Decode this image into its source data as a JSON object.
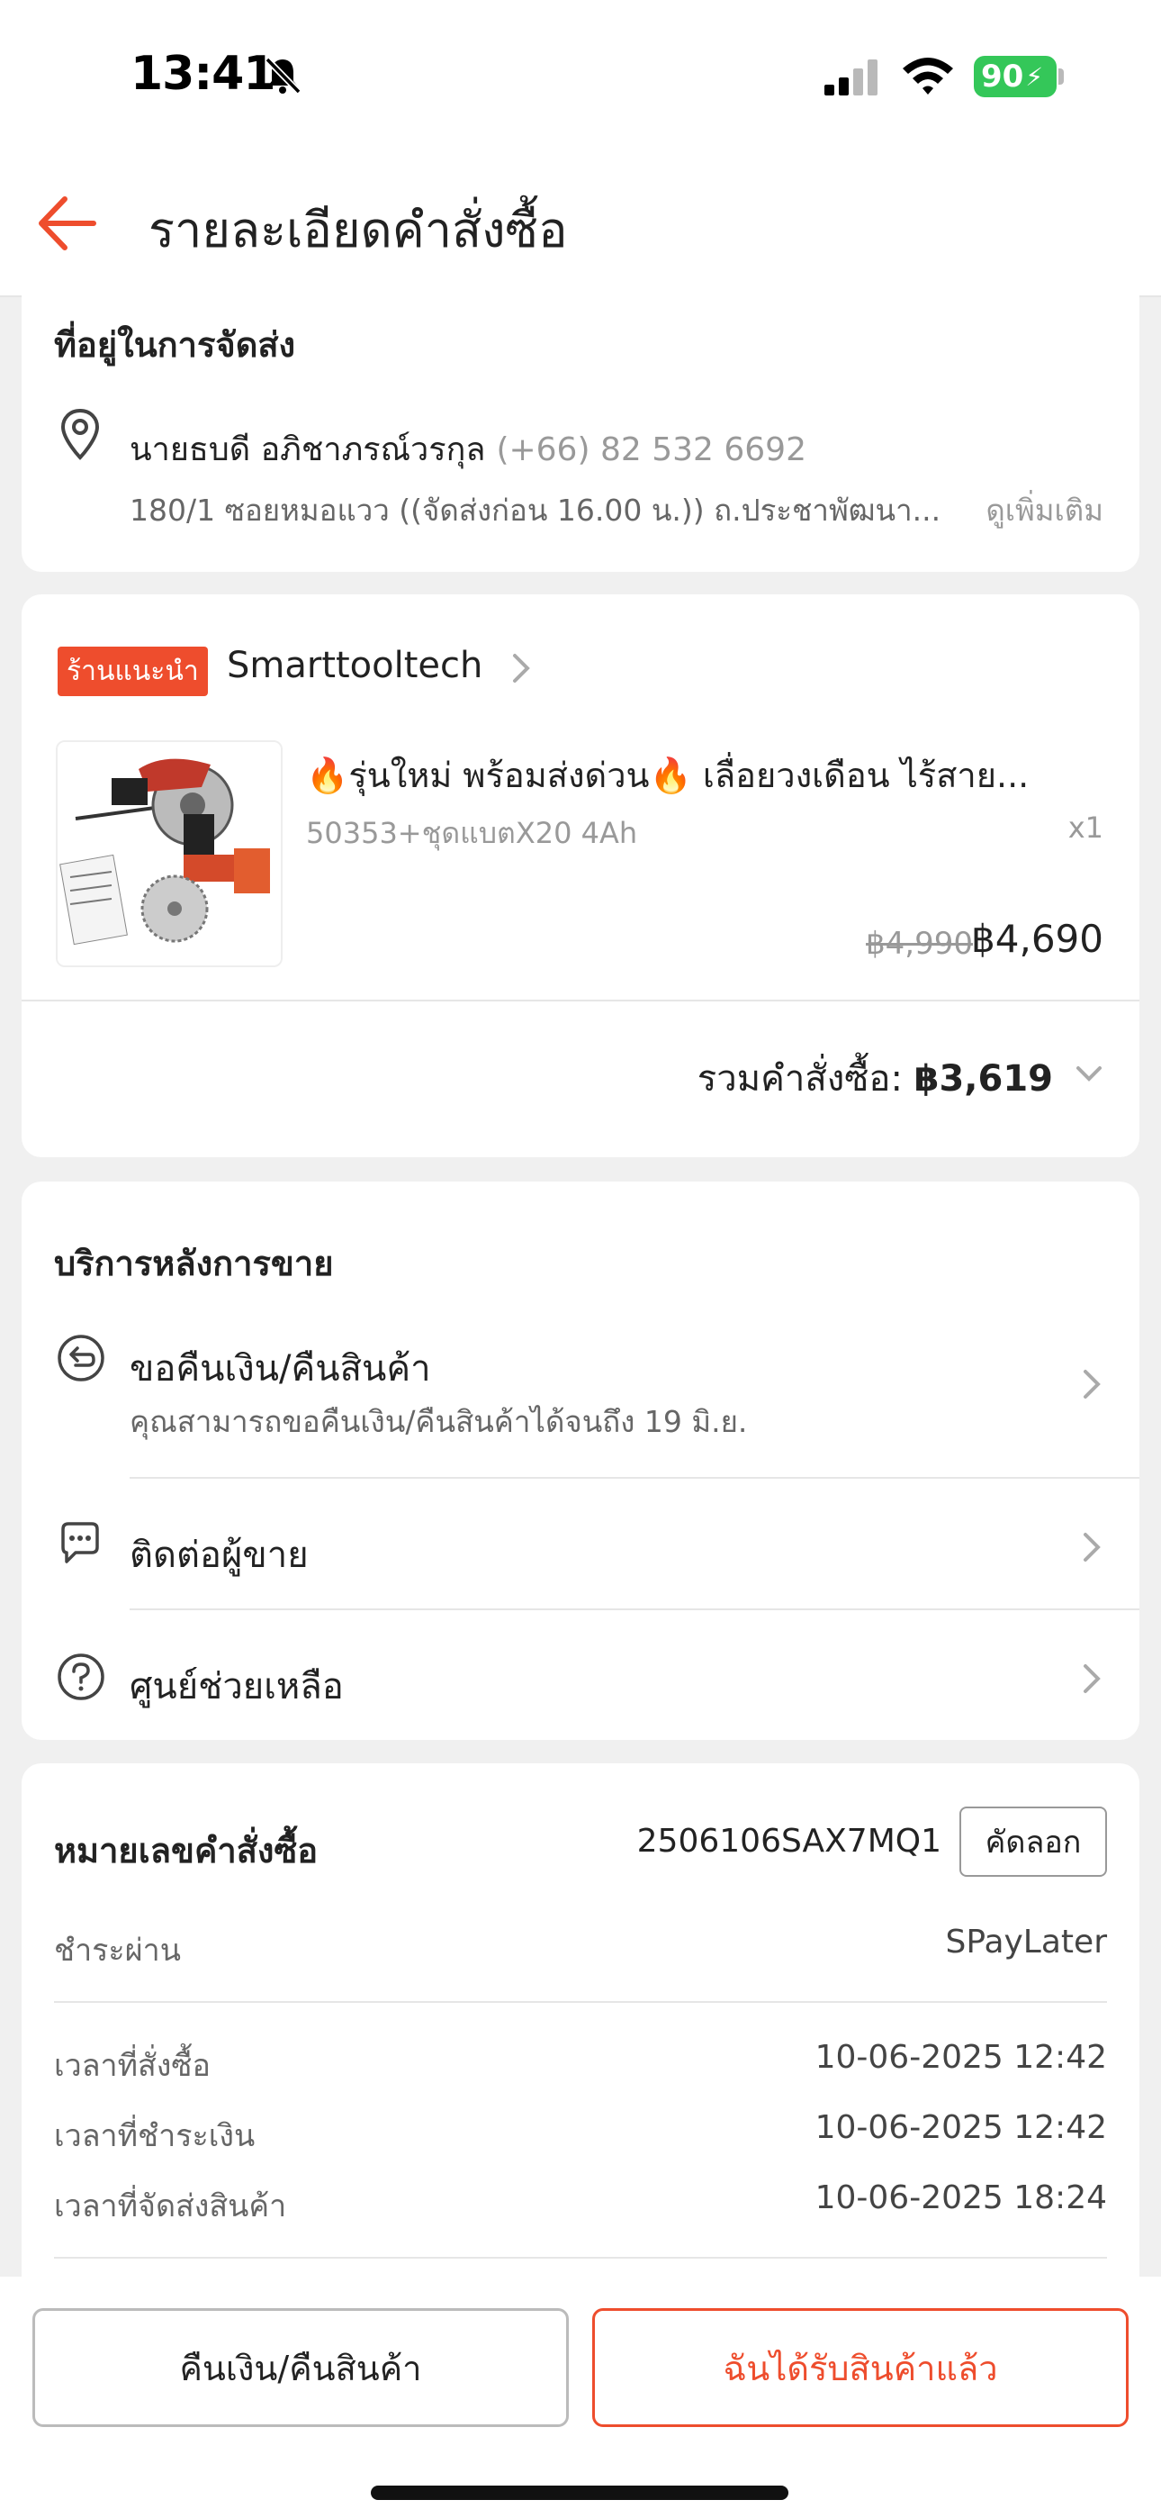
{
  "status_bar": {
    "time": "13:41",
    "battery": "90"
  },
  "header": {
    "title": "รายละเอียดคำสั่งซื้อ"
  },
  "address": {
    "section_title": "ที่อยู่ในการจัดส่ง",
    "name": "นายธบดี อภิชาภรณ์วรกุล",
    "phone": "(+66) 82 532 6692",
    "line": "180/1 ซอยหมอแวว  ((จัดส่งก่อน 16.00 น.))  ถ.ประชาพัฒนา...",
    "see_more": "ดูเพิ่มเติม"
  },
  "shop": {
    "badge": "ร้านแนะนำ",
    "name": "Smarttooltech",
    "product": {
      "title": "🔥รุ่นใหม่ พร้อมส่งด่วน🔥 เลื่อยวงเดือน ไร้สาย...",
      "variant": "50353+ชุดแบตX20 4Ah",
      "qty": "x1",
      "price_original": "฿4,990",
      "price": "฿4,690"
    },
    "total_label": "รวมคำสั่งซื้อ: ",
    "total_amount": "฿3,619"
  },
  "after_sales": {
    "section_title": "บริการหลังการขาย",
    "items": [
      {
        "label": "ขอคืนเงิน/คืนสินค้า",
        "sub": "คุณสามารถขอคืนเงิน/คืนสินค้าได้จนถึง 19 มิ.ย."
      },
      {
        "label": "ติดต่อผู้ขาย"
      },
      {
        "label": "ศูนย์ช่วยเหลือ"
      }
    ]
  },
  "order": {
    "number_label": "หมายเลขคำสั่งซื้อ",
    "number": "2506106SAX7MQ1",
    "copy_label": "คัดลอก",
    "payment_label": "ชำระผ่าน",
    "payment_value": "SPayLater",
    "rows": [
      {
        "label": "เวลาที่สั่งซื้อ",
        "value": "10-06-2025 12:42"
      },
      {
        "label": "เวลาที่ชำระเงิน",
        "value": "10-06-2025 12:42"
      },
      {
        "label": "เวลาที่จัดส่งสินค้า",
        "value": "10-06-2025 18:24"
      }
    ]
  },
  "actions": {
    "refund_label": "คืนเงิน/คืนสินค้า",
    "received_label": "ฉันได้รับสินค้าแล้ว"
  },
  "colors": {
    "accent": "#ee4d2d",
    "battery": "#34c759"
  },
  "icons": [
    "bell-muted-icon",
    "signal-icon",
    "wifi-icon",
    "back-arrow-icon",
    "location-pin-icon",
    "chevron-right-icon",
    "chevron-down-icon",
    "return-icon",
    "chat-icon",
    "help-icon"
  ]
}
